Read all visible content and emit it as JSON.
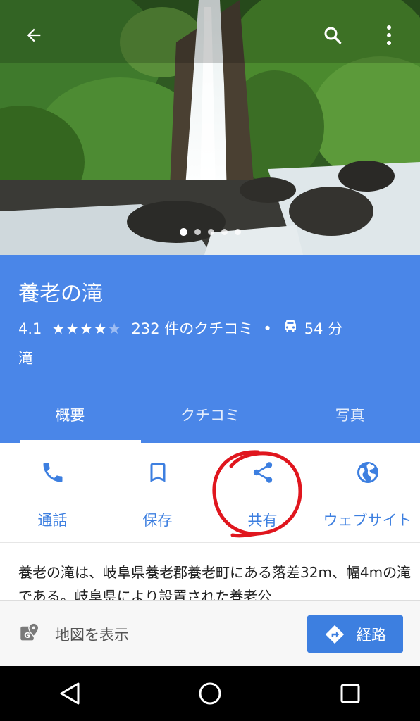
{
  "place": {
    "name": "養老の滝",
    "rating": "4.1",
    "rating_value": 4.1,
    "stars": "★★★★",
    "stars_empty": "★",
    "reviews": "232 件のクチコミ",
    "separator": "•",
    "drive_time": "54 分",
    "category": "滝"
  },
  "gallery": {
    "photo_count": 5,
    "current_index": 0
  },
  "tabs": [
    {
      "label": "概要",
      "selected": true
    },
    {
      "label": "クチコミ",
      "selected": false
    },
    {
      "label": "写真",
      "selected": false
    }
  ],
  "actions": {
    "call": "通話",
    "save": "保存",
    "share": "共有",
    "website": "ウェブサイト"
  },
  "description": "養老の滝は、岐阜県養老郡養老町にある落差32m、幅4mの滝である。岐阜県により設置された養老公",
  "bottom": {
    "map_label": "地図を表示",
    "route_label": "経路"
  },
  "colors": {
    "primary": "#4a86e8",
    "accent": "#3d7fe0",
    "annotation": "#e0161e"
  },
  "icons": {
    "back": "arrow-back-icon",
    "search": "search-icon",
    "more": "more-vert-icon",
    "call": "phone-icon",
    "save": "bookmark-icon",
    "share": "share-icon",
    "website": "globe-icon",
    "car": "car-icon",
    "map": "map-pin-icon",
    "route": "directions-icon"
  }
}
